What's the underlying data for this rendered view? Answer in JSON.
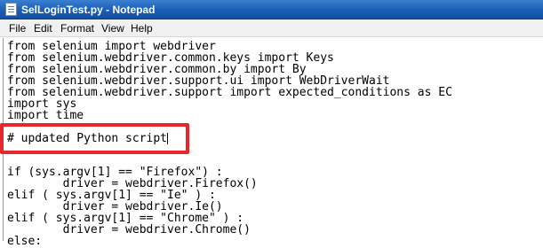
{
  "window": {
    "title": "SelLoginTest.py - Notepad"
  },
  "menu": {
    "items": [
      "File",
      "Edit",
      "Format",
      "View",
      "Help"
    ]
  },
  "editor": {
    "lines": [
      "from selenium import webdriver",
      "from selenium.webdriver.common.keys import Keys",
      "from selenium.webdriver.common.by import By",
      "from selenium.webdriver.support.ui import WebDriverWait",
      "from selenium.webdriver.support import expected_conditions as EC",
      "import sys",
      "import time",
      "# updated Python script",
      "if (sys.argv[1] == \"Firefox\") :",
      "        driver = webdriver.Firefox()",
      "elif ( sys.argv[1] == \"Ie\" ) :",
      "        driver = webdriver.Ie()",
      "elif ( sys.argv[1] == \"Chrome\" ) :",
      "        driver = webdriver.Chrome()",
      "else:"
    ]
  },
  "colors": {
    "highlight": "#e8262b",
    "titlebar": "#1a5db8"
  },
  "icons": {
    "app": "notepad-icon"
  }
}
